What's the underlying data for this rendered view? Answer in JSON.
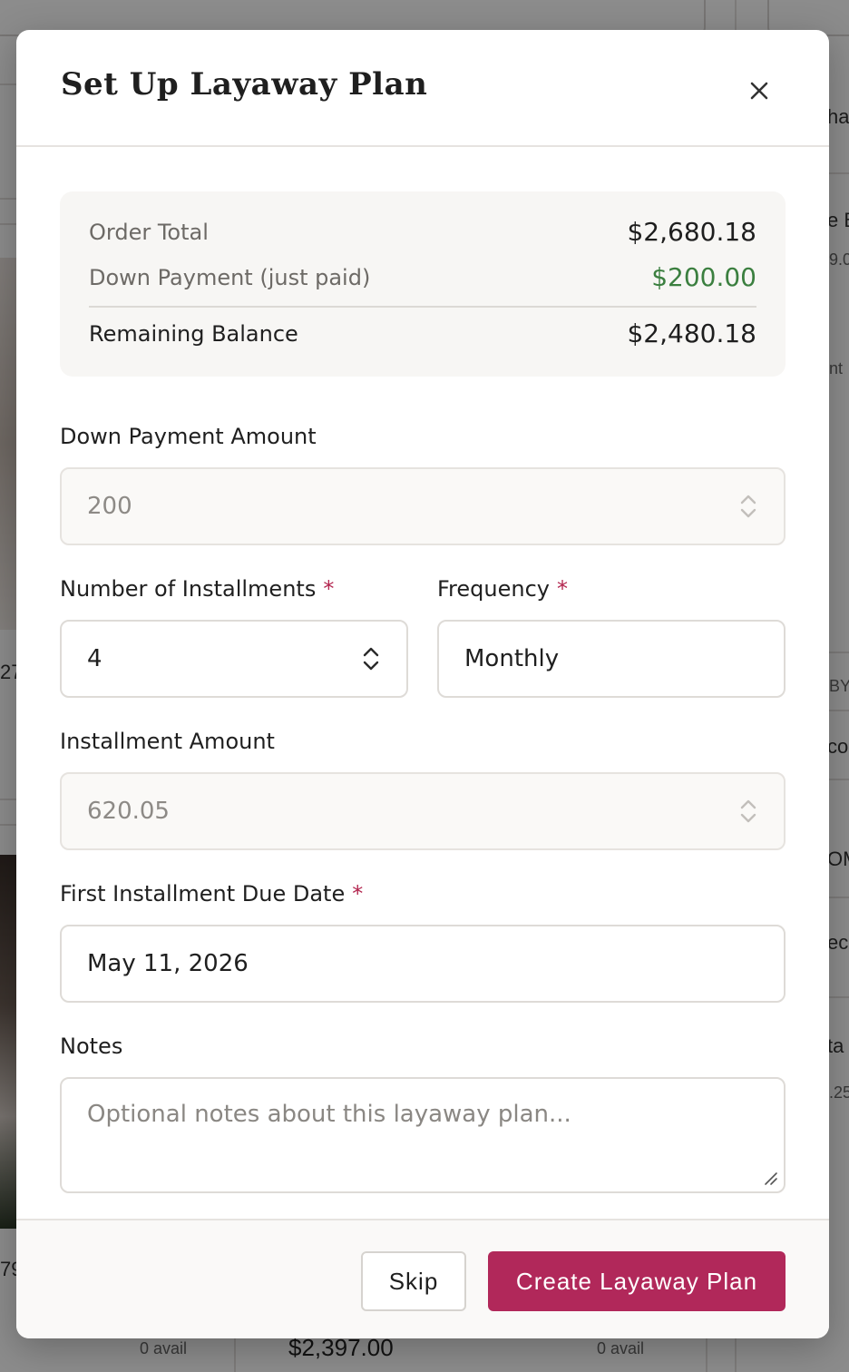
{
  "background": {
    "partial_texts": [
      "ha",
      "e B",
      "9.0",
      "nt",
      "27",
      "BY",
      "co",
      "OM",
      "ec",
      "ta",
      ".25",
      "79"
    ],
    "bottom_left_avail": "0 avail",
    "bottom_price": "$2,397.00",
    "bottom_right_avail": "0 avail"
  },
  "modal": {
    "title": "Set Up Layaway Plan",
    "close_icon": "close-icon",
    "summary": {
      "order_total_label": "Order Total",
      "order_total_value": "$2,680.18",
      "down_payment_label": "Down Payment (just paid)",
      "down_payment_value": "$200.00",
      "remaining_label": "Remaining Balance",
      "remaining_value": "$2,480.18"
    },
    "fields": {
      "down_payment": {
        "label": "Down Payment Amount",
        "value": "200"
      },
      "installments": {
        "label": "Number of Installments",
        "required_mark": "*",
        "value": "4"
      },
      "frequency": {
        "label": "Frequency",
        "required_mark": "*",
        "value": "Monthly"
      },
      "installment_amount": {
        "label": "Installment Amount",
        "value": "620.05"
      },
      "first_due_date": {
        "label": "First Installment Due Date",
        "required_mark": "*",
        "value": "May 11, 2026"
      },
      "notes": {
        "label": "Notes",
        "placeholder": "Optional notes about this layaway plan..."
      }
    },
    "footer": {
      "skip_label": "Skip",
      "create_label": "Create Layaway Plan"
    }
  },
  "colors": {
    "primary": "#b1285a",
    "positive": "#3b7f3f",
    "required": "#b3264f"
  }
}
